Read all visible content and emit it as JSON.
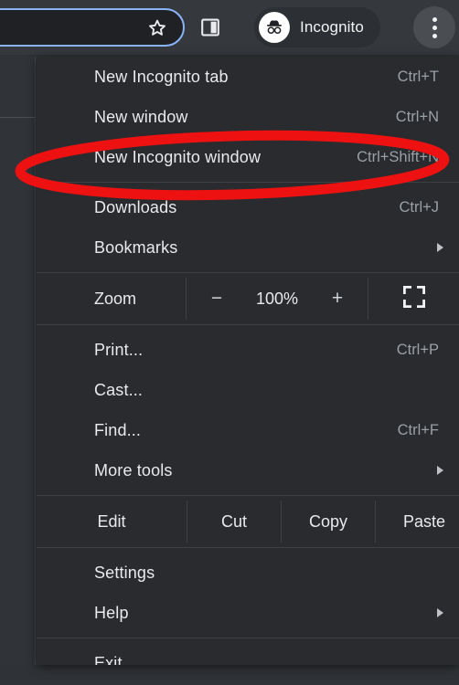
{
  "toolbar": {
    "omnibox_value": "",
    "omnibox_placeholder": "",
    "bookmark_icon": "star-icon",
    "side_panel_icon": "side-panel-icon",
    "profile_label": "Incognito",
    "profile_icon": "incognito-spy-icon",
    "menu_icon": "three-dot-menu-icon",
    "focus_ring_color": "#8ab4f8"
  },
  "menu": {
    "sections": [
      {
        "items": [
          {
            "label": "New Incognito tab",
            "accel": "Ctrl+T",
            "arrow": false
          },
          {
            "label": "New window",
            "accel": "Ctrl+N",
            "arrow": false
          },
          {
            "label": "New Incognito window",
            "accel": "Ctrl+Shift+N",
            "arrow": false
          }
        ]
      },
      {
        "items": [
          {
            "label": "Downloads",
            "accel": "Ctrl+J",
            "arrow": false
          },
          {
            "label": "Bookmarks",
            "accel": "",
            "arrow": true
          }
        ]
      },
      {
        "zoom": {
          "label": "Zoom",
          "minus": "−",
          "level": "100%",
          "plus": "+",
          "fullscreen_icon": "fullscreen-icon"
        }
      },
      {
        "items": [
          {
            "label": "Print...",
            "accel": "Ctrl+P",
            "arrow": false
          },
          {
            "label": "Cast...",
            "accel": "",
            "arrow": false
          },
          {
            "label": "Find...",
            "accel": "Ctrl+F",
            "arrow": false
          },
          {
            "label": "More tools",
            "accel": "",
            "arrow": true
          }
        ]
      },
      {
        "edit": {
          "label": "Edit",
          "cut": "Cut",
          "copy": "Copy",
          "paste": "Paste"
        }
      },
      {
        "items": [
          {
            "label": "Settings",
            "accel": "",
            "arrow": false
          },
          {
            "label": "Help",
            "accel": "",
            "arrow": true
          }
        ]
      },
      {
        "items": [
          {
            "label": "Exit",
            "accel": "",
            "arrow": false
          }
        ]
      }
    ]
  },
  "annotation": {
    "shape": "ellipse",
    "color": "#ee1111",
    "target_label": "New Incognito window"
  }
}
